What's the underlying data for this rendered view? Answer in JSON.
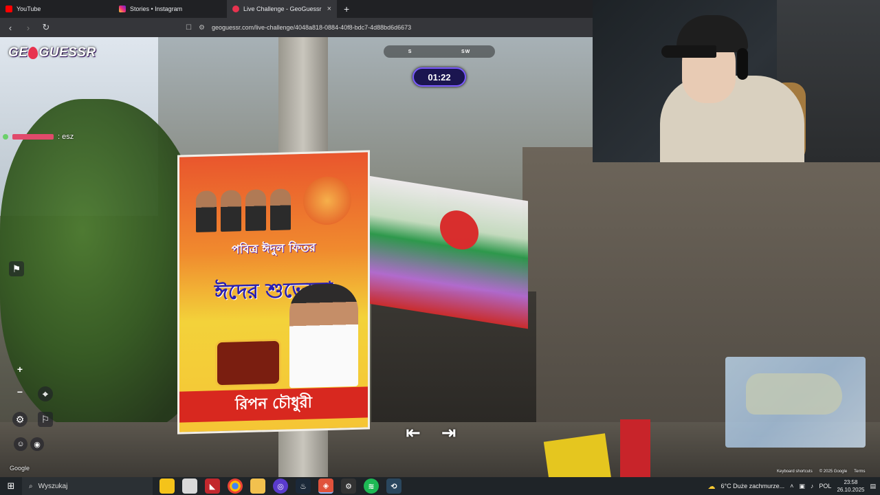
{
  "browser": {
    "tabs": [
      {
        "title": "YouTube",
        "favicon_color": "#ff0000",
        "active": false
      },
      {
        "title": "Stories • Instagram",
        "favicon_color": "#d6249f",
        "active": false
      },
      {
        "title": "Live Challenge - GeoGuessr",
        "favicon_color": "#ffffff",
        "active": true
      }
    ],
    "new_tab_symbol": "+",
    "close_symbol": "×",
    "url": "geoguessr.com/live-challenge/4048a818-0884-40f8-bdc7-4d88bd6d6673",
    "nav": {
      "back": "‹",
      "forward": "›",
      "reload": "↻"
    }
  },
  "game": {
    "logo_left": "GE",
    "logo_right": "GUESSR",
    "compass_labels": [
      "S",
      "SW"
    ],
    "timer": "01:22",
    "chat": {
      "user_suffix": ": esz"
    },
    "controls": {
      "zoom_in": "+",
      "zoom_out": "−"
    },
    "map_footer": {
      "shortcuts": "Keyboard shortcuts",
      "copyright": "© 2025 Google",
      "terms": "Terms"
    },
    "google_watermark": "Google"
  },
  "scene_text": {
    "poster_line1": "পবিত্র ঈদুল ফিতর",
    "poster_line2": "ঈদের শুভেচ্ছা",
    "poster_line3": "রিপন চৌধুরী"
  },
  "taskbar": {
    "search_placeholder": "Wyszukaj",
    "weather": "6°C  Duże zachmurze...",
    "language": "POL",
    "time": "23:58",
    "date": "26.10.2025"
  },
  "colors": {
    "timer_border": "#7b5bff",
    "timer_bg": "#1b1550",
    "logo_pin": "#e8334f"
  }
}
